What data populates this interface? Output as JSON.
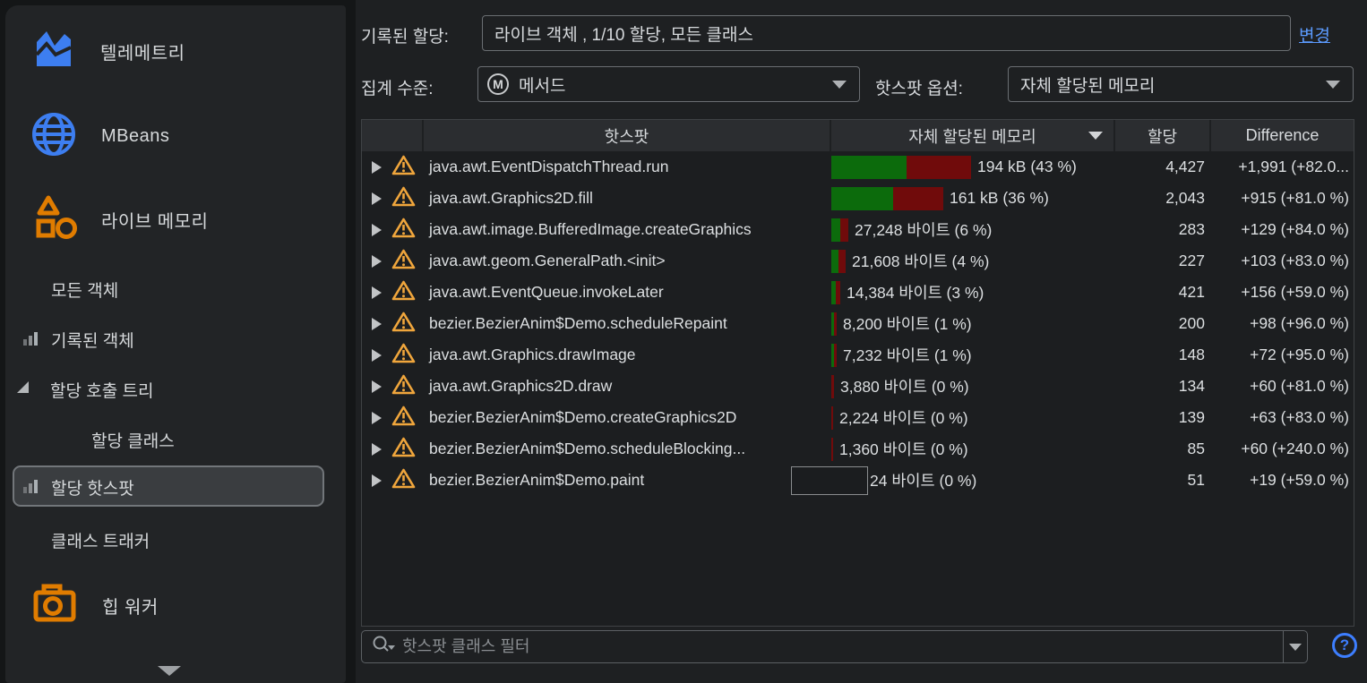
{
  "colors": {
    "accent_blue": "#3d7ef0",
    "accent_orange": "#e07c00",
    "warning_orange": "#f0a63c",
    "link_blue": "#5c9bff",
    "bar_green": "#0c6b0c",
    "bar_red": "#700b0b"
  },
  "sidebar": {
    "items": [
      {
        "label": "텔레메트리"
      },
      {
        "label": "MBeans"
      },
      {
        "label": "라이브 메모리"
      },
      {
        "label": "모든 객체"
      },
      {
        "label": "기록된 객체"
      },
      {
        "label": "할당 호출 트리"
      },
      {
        "label": "할당 클래스"
      },
      {
        "label": "할당 핫스팟",
        "selected": true
      },
      {
        "label": "클래스 트래커"
      },
      {
        "label": "힙 워커"
      }
    ]
  },
  "toolbar": {
    "recorded_label": "기록된 할당:",
    "recorded_value": "라이브 객체 , 1/10 할당, 모든 클래스",
    "change_link": "변경",
    "aggregation_label": "집계 수준:",
    "aggregation_icon_glyph": "M",
    "aggregation_value": "메서드",
    "hotspot_options_label": "핫스팟 옵션:",
    "hotspot_options_value": "자체 할당된 메모리"
  },
  "table": {
    "headers": {
      "hotspot": "핫스팟",
      "memory": "자체 할당된 메모리",
      "allocations": "할당",
      "difference": "Difference"
    },
    "sorted_by": "자체 할당된 메모리",
    "rows": [
      {
        "name": "java.awt.EventDispatchThread.run",
        "memory": "194 kB (43 %)",
        "allocations": "4,427",
        "difference": "+1,991 (+82.0...",
        "bar_green": 84,
        "bar_red": 72
      },
      {
        "name": "java.awt.Graphics2D.fill",
        "memory": "161 kB (36 %)",
        "allocations": "2,043",
        "difference": "+915 (+81.0 %)",
        "bar_green": 69,
        "bar_red": 56
      },
      {
        "name": "java.awt.image.BufferedImage.createGraphics",
        "memory": "27,248 바이트 (6 %)",
        "allocations": "283",
        "difference": "+129 (+84.0 %)",
        "bar_green": 10,
        "bar_red": 9
      },
      {
        "name": "java.awt.geom.GeneralPath.<init>",
        "memory": "21,608 바이트 (4 %)",
        "allocations": "227",
        "difference": "+103 (+83.0 %)",
        "bar_green": 8,
        "bar_red": 8
      },
      {
        "name": "java.awt.EventQueue.invokeLater",
        "memory": "14,384 바이트 (3 %)",
        "allocations": "421",
        "difference": "+156 (+59.0 %)",
        "bar_green": 5,
        "bar_red": 5
      },
      {
        "name": "bezier.BezierAnim$Demo.scheduleRepaint",
        "memory": "8,200 바이트 (1 %)",
        "allocations": "200",
        "difference": "+98 (+96.0 %)",
        "bar_green": 3,
        "bar_red": 3
      },
      {
        "name": "java.awt.Graphics.drawImage",
        "memory": "7,232 바이트 (1 %)",
        "allocations": "148",
        "difference": "+72 (+95.0 %)",
        "bar_green": 3,
        "bar_red": 3
      },
      {
        "name": "java.awt.Graphics2D.draw",
        "memory": "3,880 바이트 (0 %)",
        "allocations": "134",
        "difference": "+60 (+81.0 %)",
        "bar_green": 0,
        "bar_red": 3
      },
      {
        "name": "bezier.BezierAnim$Demo.createGraphics2D",
        "memory": "2,224 바이트 (0 %)",
        "allocations": "139",
        "difference": "+63 (+83.0 %)",
        "bar_green": 0,
        "bar_red": 2
      },
      {
        "name": "bezier.BezierAnim$Demo.scheduleBlocking...",
        "memory": "1,360 바이트 (0 %)",
        "allocations": "85",
        "difference": "+60 (+240.0 %)",
        "bar_green": 0,
        "bar_red": 2
      },
      {
        "name": "bezier.BezierAnim$Demo.paint",
        "memory": "24 바이트 (0 %)",
        "allocations": "51",
        "difference": "+19 (+59.0 %)",
        "bar_green": 0,
        "bar_red": 0,
        "overlay_box": true
      }
    ]
  },
  "filter": {
    "placeholder": "핫스팟 클래스 필터"
  },
  "help": {
    "glyph": "?"
  }
}
